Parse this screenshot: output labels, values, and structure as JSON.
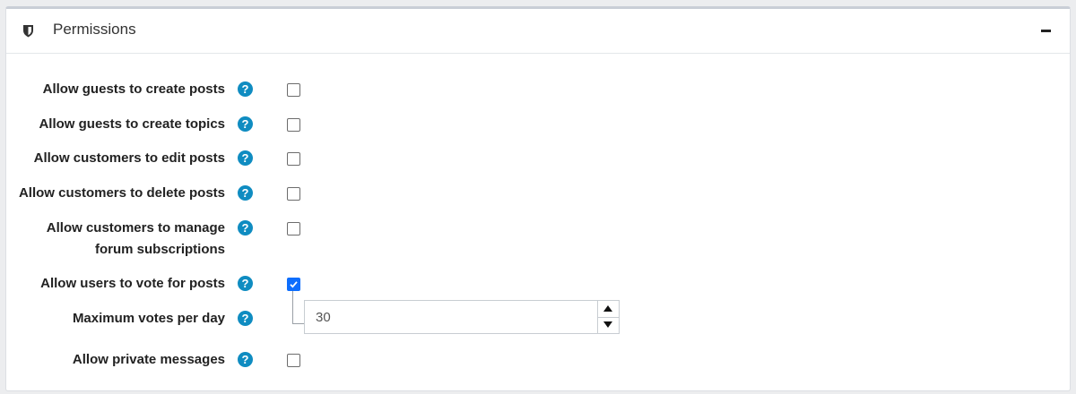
{
  "panel": {
    "title": "Permissions",
    "header_icon": "shield-icon",
    "collapse_icon": "minus-icon"
  },
  "settings": [
    {
      "label": "Allow guests to create posts",
      "checked": false
    },
    {
      "label": "Allow guests to create topics",
      "checked": false
    },
    {
      "label": "Allow customers to edit posts",
      "checked": false
    },
    {
      "label": "Allow customers to delete posts",
      "checked": false
    },
    {
      "label_line1": "Allow customers to manage",
      "label_line2": "forum subscriptions",
      "checked": false
    },
    {
      "label": "Allow users to vote for posts",
      "checked": true
    },
    {
      "label": "Maximum votes per day",
      "value": "30"
    },
    {
      "label": "Allow private messages",
      "checked": false
    }
  ],
  "help_icon": {
    "glyph": "?",
    "name": "help-icon",
    "color": "#0f8cc1"
  },
  "accent_color": "#0d6efd"
}
